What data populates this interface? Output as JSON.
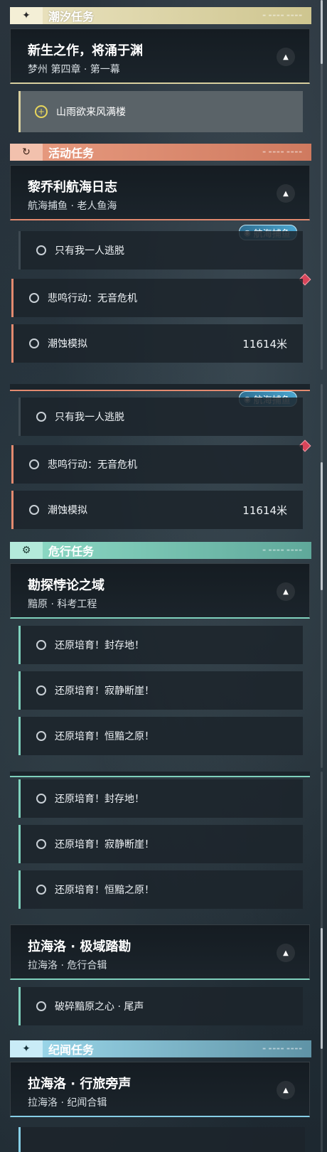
{
  "tidal": {
    "header_title": "潮汐任务",
    "header_icon": "star-icon",
    "color": "#d8cf9f",
    "card": {
      "title": "新生之作，将涌于渊",
      "subtitle": "梦州 第四章 · 第一幕"
    },
    "sub_item": {
      "label": "山雨欲来风满楼"
    }
  },
  "activity": {
    "header_title": "活动任务",
    "color": "#e38a6f",
    "card": {
      "title": "黎乔利航海日志",
      "subtitle": "航海捕鱼 · 老人鱼海"
    },
    "badge": "航海捕鱼",
    "items": [
      {
        "label": "只有我一人逃脱",
        "distance": ""
      },
      {
        "label": "悲鸣行动：无音危机",
        "distance": ""
      },
      {
        "label": "潮蚀模拟",
        "distance": "11614米"
      }
    ]
  },
  "danger": {
    "header_title": "危行任务",
    "color": "#7fd1bd",
    "card": {
      "title": "勘探悖论之域",
      "subtitle": "黯原 · 科考工程"
    },
    "items": [
      {
        "label": "还原培育！封存地！"
      },
      {
        "label": "还原培育！寂静断崖！"
      },
      {
        "label": "还原培育！恒黯之原！"
      }
    ],
    "card2": {
      "title": "拉海洛 · 极域踏勘",
      "subtitle": "拉海洛 · 危行合辑"
    },
    "card2_item": {
      "label": "破碎黯原之心 · 尾声"
    }
  },
  "legend": {
    "header_title": "纪闻任务",
    "color": "#86cfe6",
    "card": {
      "title": "拉海洛 · 行旅旁声",
      "subtitle": "拉海洛 · 纪闻合辑"
    }
  }
}
